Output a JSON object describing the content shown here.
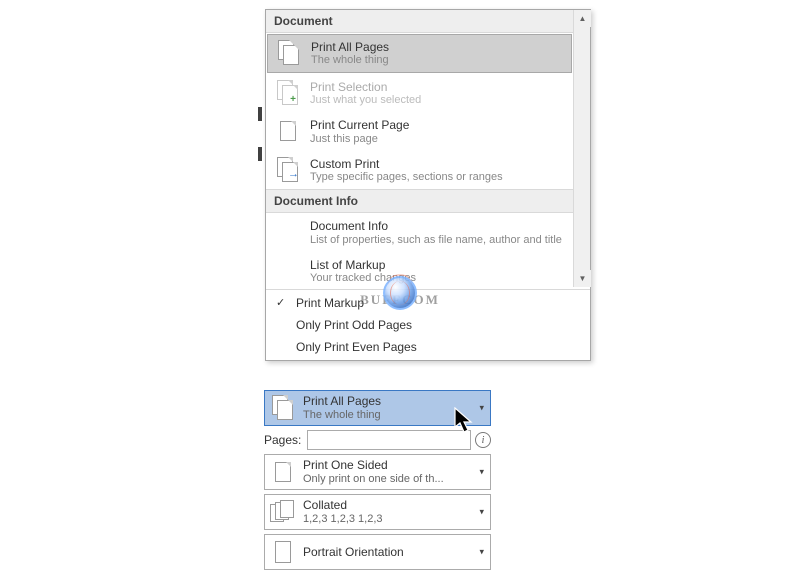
{
  "dropdown": {
    "header_document": "Document",
    "items": {
      "print_all": {
        "title": "Print All Pages",
        "sub": "The whole thing"
      },
      "print_selection": {
        "title": "Print Selection",
        "sub": "Just what you selected"
      },
      "print_current": {
        "title": "Print Current Page",
        "sub": "Just this page"
      },
      "custom_print": {
        "title": "Custom Print",
        "sub": "Type specific pages, sections or ranges"
      }
    },
    "header_info": "Document Info",
    "info_items": {
      "doc_info": {
        "title": "Document Info",
        "sub": "List of properties, such as file name, author and title"
      },
      "list_markup": {
        "title": "List of Markup",
        "sub": "Your tracked changes"
      }
    },
    "simple": {
      "print_markup": "Print Markup",
      "only_odd": "Only Print Odd Pages",
      "only_even": "Only Print Even Pages"
    }
  },
  "settings": {
    "pages_label": "Pages:",
    "pages_value": "",
    "selected": {
      "title": "Print All Pages",
      "sub": "The whole thing"
    },
    "one_sided": {
      "title": "Print One Sided",
      "sub": "Only print on one side of th..."
    },
    "collated": {
      "title": "Collated",
      "sub": "1,2,3    1,2,3    1,2,3"
    },
    "orientation": {
      "title": "Portrait Orientation"
    }
  },
  "watermark": {
    "text": "BUFFCOM"
  },
  "icons": {
    "check": "✓",
    "caret": "▾",
    "info": "i",
    "scroll_up": "▲",
    "scroll_down": "▼"
  }
}
